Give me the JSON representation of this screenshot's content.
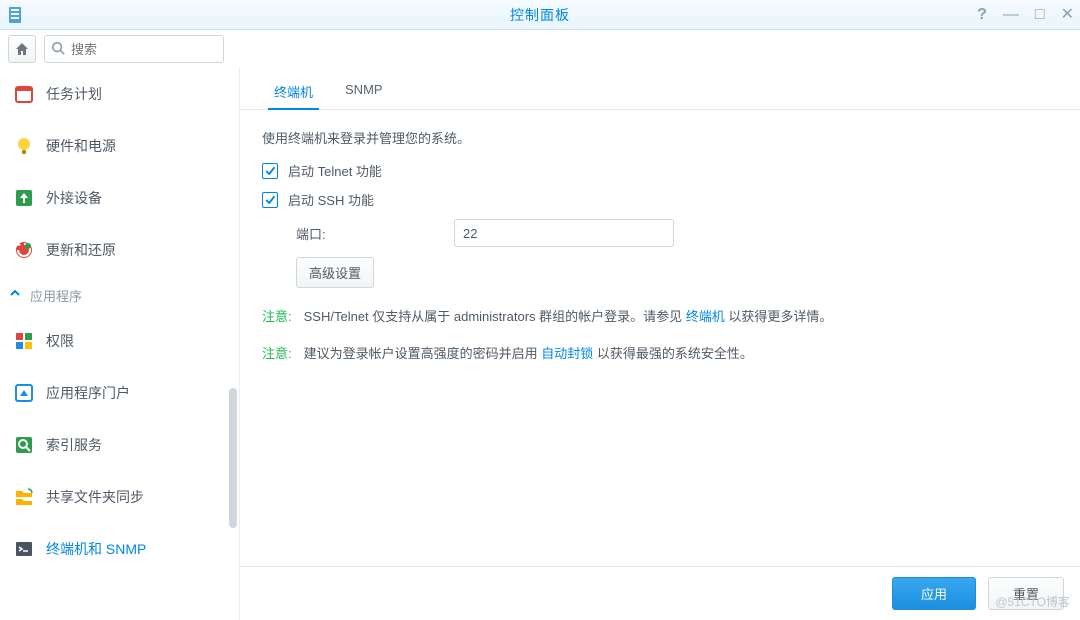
{
  "window": {
    "title": "控制面板"
  },
  "toolbar": {
    "search_placeholder": "搜索"
  },
  "sidebar": {
    "items": [
      {
        "label": "任务计划",
        "icon": "calendar"
      },
      {
        "label": "硬件和电源",
        "icon": "bulb"
      },
      {
        "label": "外接设备",
        "icon": "upload"
      },
      {
        "label": "更新和还原",
        "icon": "refresh"
      }
    ],
    "category_label": "应用程序",
    "items2": [
      {
        "label": "权限",
        "icon": "grid"
      },
      {
        "label": "应用程序门户",
        "icon": "portal"
      },
      {
        "label": "索引服务",
        "icon": "search-doc"
      },
      {
        "label": "共享文件夹同步",
        "icon": "sync"
      },
      {
        "label": "终端机和 SNMP",
        "icon": "terminal"
      }
    ]
  },
  "tabs": {
    "terminal": "终端机",
    "snmp": "SNMP"
  },
  "panel": {
    "intro": "使用终端机来登录并管理您的系统。",
    "telnet_label": "启动 Telnet 功能",
    "ssh_label": "启动 SSH 功能",
    "port_label": "端口:",
    "port_value": "22",
    "advanced_label": "高级设置",
    "note_label": "注意:",
    "note1_pre": "SSH/Telnet 仅支持从属于 administrators 群组的帐户登录。请参见 ",
    "note1_link": "终端机",
    "note1_post": " 以获得更多详情。",
    "note2_pre": "建议为登录帐户设置高强度的密码并启用 ",
    "note2_link": "自动封锁",
    "note2_post": " 以获得最强的系统安全性。"
  },
  "footer": {
    "apply": "应用",
    "reset": "重置"
  },
  "watermark": "@51CTO博客"
}
